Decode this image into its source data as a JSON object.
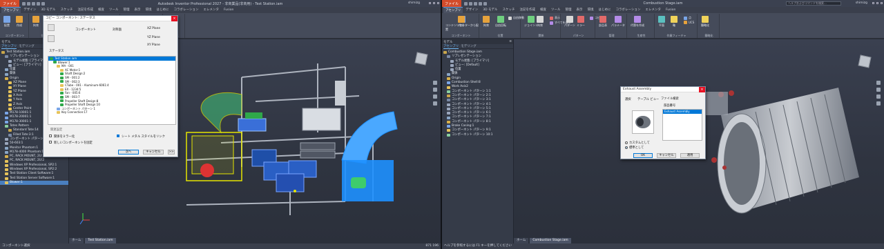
{
  "left": {
    "window_title": "Autodesk Inventor Professional 2027 - 非商業品(非商用) - Test Station.iam",
    "file_tab": "ファイル",
    "user": "shimizg",
    "ribbon_tabs": [
      "アセンブリ",
      "デザイン",
      "3D モデル",
      "スケッチ",
      "注記を作成",
      "検査",
      "ツール",
      "管理",
      "表示",
      "環境",
      "はじめに",
      "コラボレーション",
      "エレメンタ",
      "Fusion"
    ],
    "ribbon_groups": [
      {
        "label": "コンポーネント",
        "buttons": [
          "配置",
          "作成"
        ]
      },
      {
        "label": "位置",
        "buttons": [
          "拘束",
          "ジョイント"
        ]
      },
      {
        "label": "",
        "buttons": [
          "パターン",
          "ミラー",
          "コピー"
        ]
      },
      {
        "label": "生産性",
        "buttons": [
          "代替を作成"
        ]
      },
      {
        "label": "作業フィーチャ",
        "buttons": [
          "平面",
          "軸",
          "点",
          "UCS"
        ]
      },
      {
        "label": "簡略化",
        "buttons": [
          "簡略化"
        ]
      }
    ],
    "browser": {
      "header": "モデル",
      "tabs": [
        "アセンブリ",
        "モデリング"
      ],
      "nodes": [
        "Test Station.iam",
        "リプレゼンテーション",
        "モデル状態: [プライマリ]",
        "ビュー: [プライマリ]",
        "位置",
        "関係",
        "Origin",
        "XZ Plane",
        "XY Plane",
        "YZ Plane",
        "X Axis",
        "Y Axis",
        "Z Axis",
        "Center Point",
        "M178-10001:1",
        "M178-20001:1",
        "M178-30001:1",
        "Totes Pattern",
        "Standard Tote:14",
        "Filled Tote:3:1",
        "コンポーネント パターン 3:1",
        "50-603:1",
        "Monitor Phantom:1",
        "M178-4000 Phantom:1",
        "PC, RACK MOUNT, 2U:1",
        "PC, RACK MOUNT, 2U:2",
        "Windows XP Professional, SP2:1",
        "Windows XP Professional, SP2:2",
        "Test Station Client Software:1",
        "Test Station Server Software:1",
        "Blower:1"
      ]
    },
    "dialog": {
      "title": "コピー コンポーネント: ステータス",
      "btn_component": "コンポーネント",
      "btn_object": "対称面",
      "planes": [
        "XZ Plane",
        "YZ Plane",
        "XY Plane"
      ],
      "status_label": "ステータス",
      "tree": [
        "Test Station.iam",
        "Blower:1",
        "MA - 001",
        "AC Motor:1",
        "Shaft Design:2",
        "SM - 001:2",
        "SM - 002:3",
        "CTube - 001 - Aluminum-6061:4",
        "EX - 1234:5",
        "Fan - 005:6",
        "SM - 003:7",
        "Propeller Shaft Design:8",
        "Propeller Shaft Design:10",
        "コンポーネント パターン 1",
        "Key Connection:17"
      ],
      "section": "関連設定",
      "chk_mirror": "関係をミラー化",
      "chk_newname": "新しいコンポーネントを固定",
      "chk_sheetmetal": "シート メタル スタイルをリンク",
      "next": "次へ",
      "cancel": "キャンセル",
      "expand": ">>"
    },
    "doc_tabs": [
      "ホーム",
      "Test Station.iam"
    ],
    "status": "コンポーネント選択",
    "status_right": "871  196"
  },
  "right": {
    "window_title": "Combustion Stage.iam",
    "file_tab": "ファイル",
    "search": "ヘルプおよびコマンドを検索...",
    "user": "shimizg",
    "ribbon_tabs": [
      "アセンブリ",
      "デザイン",
      "3D モデル",
      "スケッチ",
      "注記を作成",
      "検査",
      "ツール",
      "管理",
      "表示",
      "環境",
      "はじめに",
      "コラボレーション",
      "エレメンタ",
      "Fusion"
    ],
    "ribbon_groups": [
      {
        "label": "コンポーネント",
        "buttons": [
          "コンテンツセンターから配置",
          "作成"
        ]
      },
      {
        "label": "位置",
        "buttons": [
          "拘束",
          "自由回転",
          "自由移動"
        ]
      },
      {
        "label": "関係",
        "buttons": [
          "ジョイント",
          "拘束",
          "表示",
          "すべてを表示"
        ]
      },
      {
        "label": "パターン",
        "buttons": [
          "パターン",
          "ミラー",
          "コピー"
        ]
      },
      {
        "label": "管理",
        "buttons": [
          "部品表",
          "パラメータ"
        ]
      },
      {
        "label": "生産性",
        "buttons": [
          "代替を作成"
        ]
      },
      {
        "label": "作業フィーチャ",
        "buttons": [
          "平面",
          "軸",
          "点",
          "UCS"
        ]
      },
      {
        "label": "簡略化",
        "buttons": [
          "簡略化"
        ]
      }
    ],
    "browser": {
      "header": "モデル",
      "tabs": [
        "アセンブリ",
        "モデリング"
      ],
      "nodes": [
        "Combustion Stage.iam",
        "リプレゼンテーション",
        "モデル状態: [プライマリ]",
        "ビュー: [Default]",
        "位置",
        "関係",
        "Origin",
        "Combustion Shell:8",
        "Work Axis2",
        "コンポーネント パターン 1:1",
        "コンポーネント パターン 2:1",
        "コンポーネント パターン 3:1",
        "コンポーネント パターン 4:1",
        "コンポーネント パターン 5:1",
        "コンポーネント パターン 6:1",
        "コンポーネント パターン 7:1",
        "コンポーネント パターン 8:1",
        "Brake Casing:1",
        "コンポーネント パターン 9:1",
        "コンポーネント パターン 10:1"
      ]
    },
    "dialog": {
      "title": "Exhaust Assembly",
      "tabs": [
        "選択",
        "テーブル ビュー",
        "ファイル検索"
      ],
      "col_header": "部品番号",
      "selected_item": "Exhaust Assembly",
      "radio1": "カスタムとして",
      "radio2": "標準として",
      "ok": "OK",
      "cancel": "キャンセル",
      "apply": "適用"
    },
    "doc_tabs": [
      "ホーム",
      "Combustion Stage.iam"
    ],
    "status": "ヘルプを参照するには F1 キーを押してください"
  },
  "colors": {
    "accent": "#0078d7",
    "file_tab": "#d24b2a",
    "blower_blue": "#1e90ff",
    "blower_green": "#5fd35f",
    "select_yellow": "#e6e600"
  }
}
